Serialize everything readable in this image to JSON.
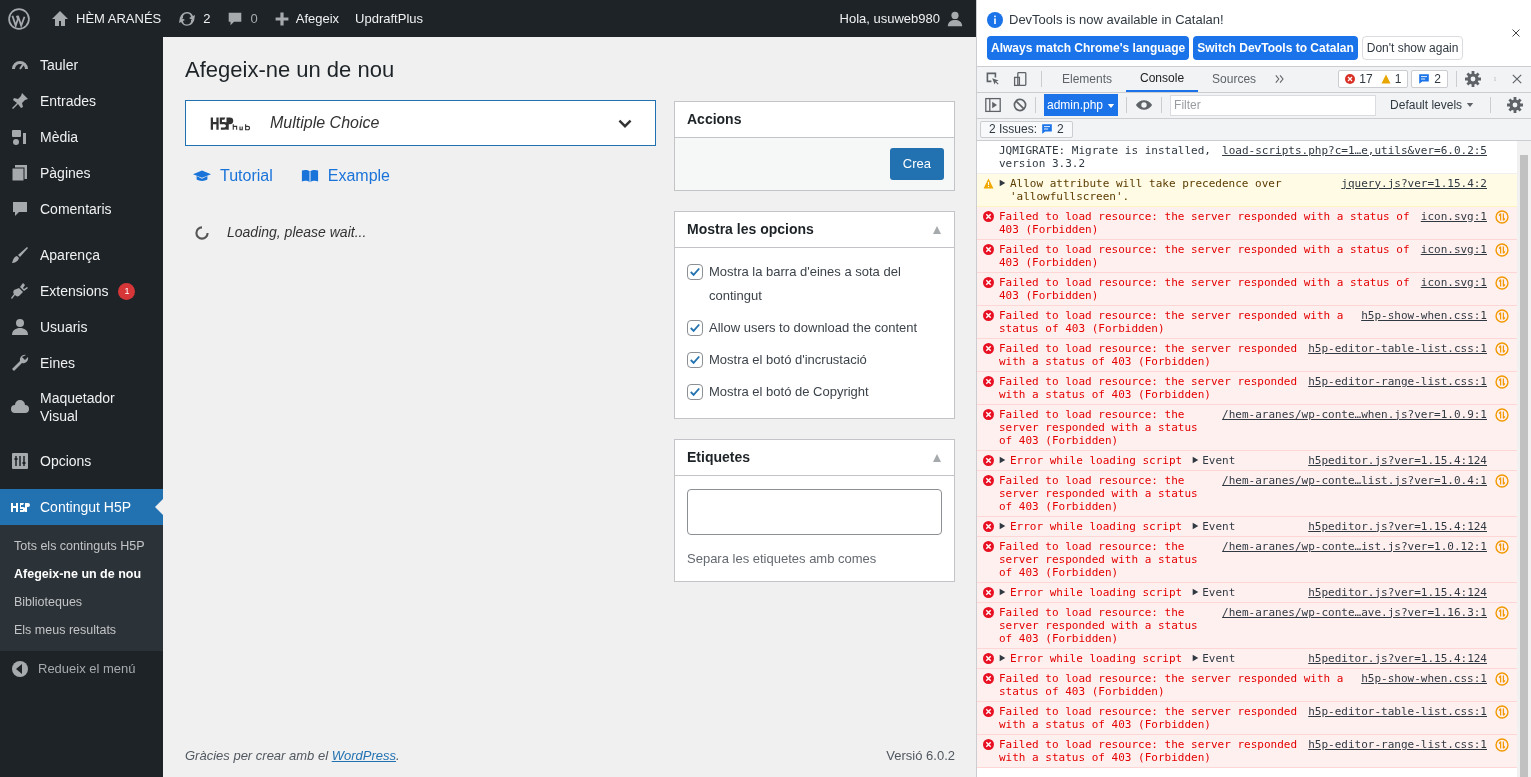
{
  "admin_bar": {
    "site": "HÈM ARANÉS",
    "updates": "2",
    "comments": "0",
    "new": "Afegeix",
    "plugin": "UpdraftPlus",
    "greeting": "Hola, usuweb980"
  },
  "sidebar": {
    "items": [
      {
        "label": "Tauler",
        "selected": false
      },
      {
        "label": "Entrades",
        "selected": false
      },
      {
        "label": "Mèdia",
        "selected": false
      },
      {
        "label": "Pàgines",
        "selected": false
      },
      {
        "label": "Comentaris",
        "selected": false
      },
      {
        "label": "Aparença",
        "selected": false
      },
      {
        "label": "Extensions",
        "selected": false,
        "badge": "1"
      },
      {
        "label": "Usuaris",
        "selected": false
      },
      {
        "label": "Eines",
        "selected": false
      },
      {
        "label": "Maquetador Visual",
        "selected": false
      },
      {
        "label": "Opcions",
        "selected": false
      },
      {
        "label": "Contingut H5P",
        "selected": true
      }
    ],
    "submenu": [
      {
        "label": "Tots els continguts H5P",
        "selected": false
      },
      {
        "label": "Afegeix-ne un de nou",
        "selected": true
      },
      {
        "label": "Biblioteques",
        "selected": false
      },
      {
        "label": "Els meus resultats",
        "selected": false
      }
    ],
    "collapse": "Redueix el menú"
  },
  "page": {
    "title": "Afegeix-ne un de nou",
    "hub": {
      "content_type": "Multiple Choice"
    },
    "links": [
      {
        "label": "Tutorial"
      },
      {
        "label": "Example"
      }
    ],
    "loading": "Loading, please wait...",
    "boxes": [
      {
        "kind": "actions",
        "title": "Accions",
        "button": "Crea"
      },
      {
        "kind": "options",
        "title": "Mostra les opcions",
        "options": [
          {
            "label": "Mostra la barra d'eines a sota del contingut",
            "checked": true
          },
          {
            "label": "Allow users to download the content",
            "checked": true
          },
          {
            "label": "Mostra el botó d'incrustació",
            "checked": true
          },
          {
            "label": "Mostra el botó de Copyright",
            "checked": true
          }
        ]
      },
      {
        "kind": "tags",
        "title": "Etiquetes",
        "hint": "Separa les etiquetes amb comes"
      }
    ],
    "footer": {
      "thanks": "Gràcies per crear amb el",
      "link": "WordPress",
      "end": ".",
      "version": "Versió 6.0.2"
    }
  },
  "devtools": {
    "infobar": {
      "message": "DevTools is now available in Catalan!",
      "buttons": [
        {
          "label": "Always match Chrome's language",
          "primary": true
        },
        {
          "label": "Switch DevTools to Catalan",
          "primary": true
        },
        {
          "label": "Don't show again",
          "primary": false
        }
      ]
    },
    "tabs": [
      {
        "label": "Elements",
        "selected": false
      },
      {
        "label": "Console",
        "selected": true
      },
      {
        "label": "Sources",
        "selected": false
      }
    ],
    "counts": {
      "errors": "17",
      "warnings": "1",
      "issues": "2"
    },
    "context": "admin.php",
    "filter_placeholder": "Filter",
    "levels": "Default levels",
    "issues_label": "2 Issues:",
    "issues_count": "2",
    "messages": [
      {
        "kind": "info",
        "text": "JQMIGRATE: Migrate is installed, version 3.3.2",
        "source": "load-scripts.php?c=1…e,utils&ver=6.0.2:5",
        "expandable": false,
        "network": false
      },
      {
        "kind": "warning",
        "text": "Allow attribute will take precedence over 'allowfullscreen'.",
        "source": "jquery.js?ver=1.15.4:2",
        "expandable": true,
        "network": false
      },
      {
        "kind": "error",
        "text": "Failed to load resource: the server responded with a status of 403 (Forbidden)",
        "source": "icon.svg:1",
        "expandable": false,
        "network": true
      },
      {
        "kind": "error",
        "text": "Failed to load resource: the server responded with a status of 403 (Forbidden)",
        "source": "icon.svg:1",
        "expandable": false,
        "network": true
      },
      {
        "kind": "error",
        "text": "Failed to load resource: the server responded with a status of 403 (Forbidden)",
        "source": "icon.svg:1",
        "expandable": false,
        "network": true
      },
      {
        "kind": "error",
        "text": "Failed to load resource: the server responded with a status of 403 (Forbidden)",
        "source": "h5p-show-when.css:1",
        "expandable": false,
        "network": true
      },
      {
        "kind": "error",
        "text": "Failed to load resource: the server responded with a status of 403 (Forbidden)",
        "source": "h5p-editor-table-list.css:1",
        "expandable": false,
        "network": true
      },
      {
        "kind": "error",
        "text": "Failed to load resource: the server responded with a status of 403 (Forbidden)",
        "source": "h5p-editor-range-list.css:1",
        "expandable": false,
        "network": true
      },
      {
        "kind": "error",
        "text": "Failed to load resource: the server responded with a status of 403 (Forbidden)",
        "source": "/hem-aranes/wp-conte…when.js?ver=1.0.9:1",
        "expandable": false,
        "network": true
      },
      {
        "kind": "error",
        "text": "Error while loading script",
        "event": "Event",
        "source": "h5peditor.js?ver=1.15.4:124",
        "expandable": true,
        "network": false
      },
      {
        "kind": "error",
        "text": "Failed to load resource: the server responded with a status of 403 (Forbidden)",
        "source": "/hem-aranes/wp-conte…list.js?ver=1.0.4:1",
        "expandable": false,
        "network": true
      },
      {
        "kind": "error",
        "text": "Error while loading script",
        "event": "Event",
        "source": "h5peditor.js?ver=1.15.4:124",
        "expandable": true,
        "network": false
      },
      {
        "kind": "error",
        "text": "Failed to load resource: the server responded with a status of 403 (Forbidden)",
        "source": "/hem-aranes/wp-conte…ist.js?ver=1.0.12:1",
        "expandable": false,
        "network": true
      },
      {
        "kind": "error",
        "text": "Error while loading script",
        "event": "Event",
        "source": "h5peditor.js?ver=1.15.4:124",
        "expandable": true,
        "network": false
      },
      {
        "kind": "error",
        "text": "Failed to load resource: the server responded with a status of 403 (Forbidden)",
        "source": "/hem-aranes/wp-conte…ave.js?ver=1.16.3:1",
        "expandable": false,
        "network": true
      },
      {
        "kind": "error",
        "text": "Error while loading script",
        "event": "Event",
        "source": "h5peditor.js?ver=1.15.4:124",
        "expandable": true,
        "network": false
      },
      {
        "kind": "error",
        "text": "Failed to load resource: the server responded with a status of 403 (Forbidden)",
        "source": "h5p-show-when.css:1",
        "expandable": false,
        "network": true
      },
      {
        "kind": "error",
        "text": "Failed to load resource: the server responded with a status of 403 (Forbidden)",
        "source": "h5p-editor-table-list.css:1",
        "expandable": false,
        "network": true
      },
      {
        "kind": "error",
        "text": "Failed to load resource: the server responded with a status of 403 (Forbidden)",
        "source": "h5p-editor-range-list.css:1",
        "expandable": false,
        "network": true
      }
    ]
  }
}
